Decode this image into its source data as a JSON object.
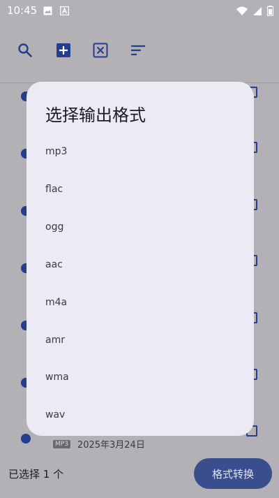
{
  "status_bar": {
    "time": "10:45",
    "left_icons": [
      "image-icon",
      "a-icon"
    ],
    "right_icons": [
      "wifi-icon",
      "signal-icon",
      "battery-icon"
    ]
  },
  "toolbar": {
    "icons": [
      "search-icon",
      "add-icon",
      "clear-icon",
      "sort-icon"
    ]
  },
  "background_list": {
    "visible_item_date": "2025年3月24日",
    "visible_item_badge": "MP3"
  },
  "bottom_bar": {
    "selected_count_label": "已选择 1 个",
    "convert_button_label": "格式转换"
  },
  "dialog": {
    "title": "选择输出格式",
    "options": [
      "mp3",
      "flac",
      "ogg",
      "aac",
      "m4a",
      "amr",
      "wma",
      "wav"
    ]
  },
  "colors": {
    "accent": "#233e8c",
    "button_bg": "#3a4d8d",
    "dialog_bg": "#ecebf5",
    "scrim_bg": "#b3b1b6"
  }
}
